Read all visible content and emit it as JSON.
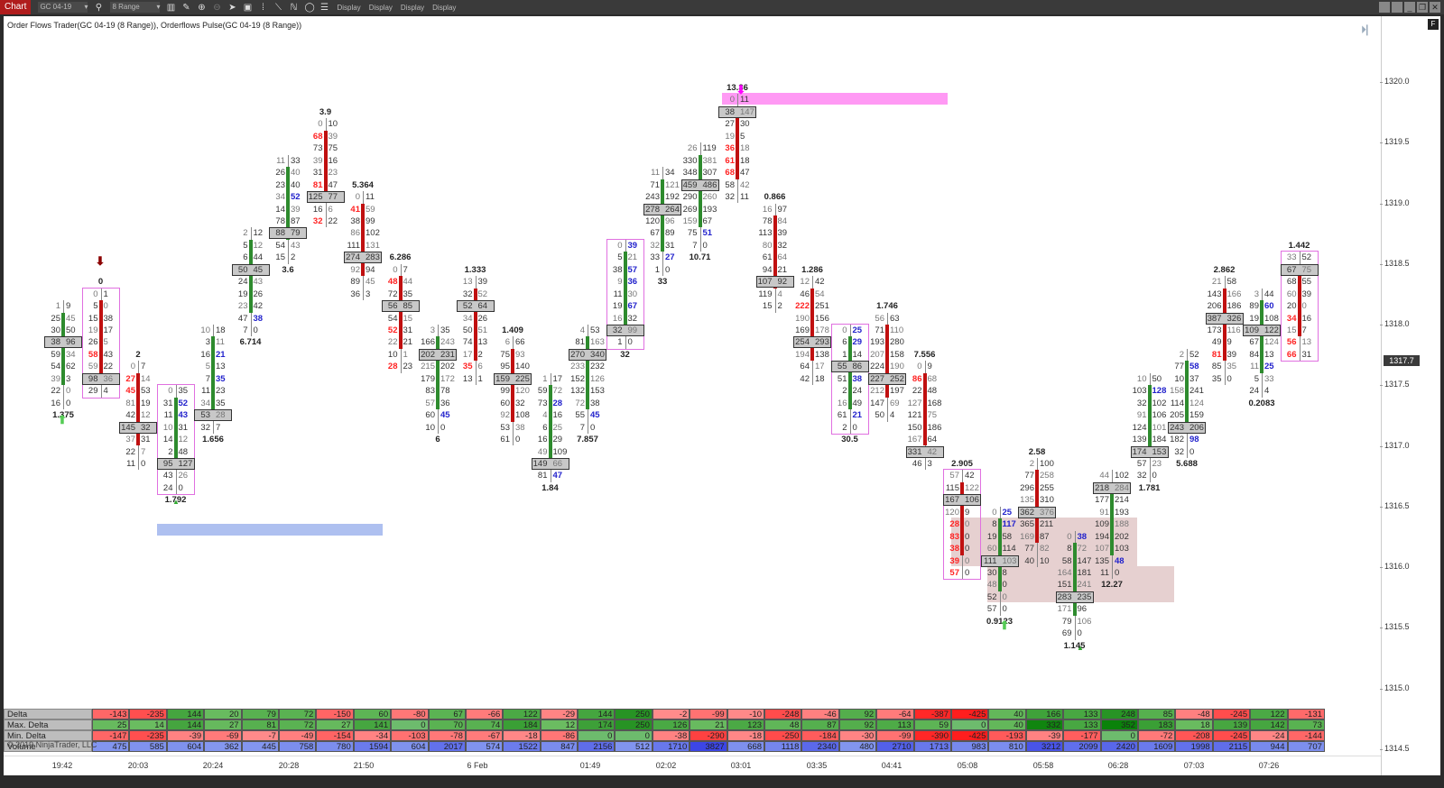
{
  "toolbar": {
    "tab": "Chart",
    "instrument": "GC 04-19",
    "bar_type": "8 Range",
    "display_buttons": [
      "Display",
      "Display",
      "Display",
      "Display"
    ]
  },
  "chart": {
    "title": "Order Flows Trader(GC 04-19 (8 Range)),  Orderflows Pulse(GC 04-19 (8 Range))",
    "f_badge": "F",
    "copyright": "© 2019 NinjaTrader, LLC",
    "last_price": "1317.7",
    "price_ticks": [
      "1320.0",
      "1319.5",
      "1319.0",
      "1318.5",
      "1318.0",
      "1317.5",
      "1317.0",
      "1316.5",
      "1316.0",
      "1315.5",
      "1315.0",
      "1314.5"
    ],
    "time_labels": [
      "19:42",
      "20:03",
      "20:24",
      "20:28",
      "21:50",
      "6 Feb",
      "01:49",
      "02:02",
      "03:01",
      "03:35",
      "04:41",
      "05:08",
      "05:58",
      "06:28",
      "07:03",
      "07:26"
    ]
  },
  "colors": {
    "up": "#2e8b2e",
    "down": "#c01010",
    "poc": "#c8c8c8",
    "highlight": "#e070e0"
  },
  "footprint_bars": [
    {
      "top": 1318.2,
      "dir": "up",
      "bid": [
        1,
        25,
        30,
        38,
        59,
        54,
        39,
        22,
        16
      ],
      "ask": [
        9,
        45,
        50,
        96,
        34,
        62,
        3,
        0,
        0
      ],
      "poc": 3,
      "label": "1.375",
      "label_pos": "bottom"
    },
    {
      "top": 1318.3,
      "dir": "down",
      "bid": [
        0,
        5,
        15,
        19,
        26,
        58,
        59,
        98,
        29
      ],
      "ask": [
        1,
        0,
        38,
        17,
        5,
        43,
        22,
        36,
        4
      ],
      "poc": 7,
      "label": "0",
      "label_pos": "top",
      "boxed": true
    },
    {
      "top": 1317.7,
      "dir": "down",
      "bid": [
        0,
        27,
        45,
        81,
        42,
        145,
        37,
        22,
        11
      ],
      "ask": [
        7,
        14,
        53,
        19,
        12,
        32,
        31,
        7,
        0
      ],
      "poc": 5,
      "label": "2",
      "label_pos": "top"
    },
    {
      "top": 1317.5,
      "dir": "up",
      "bid": [
        0,
        31,
        11,
        10,
        14,
        2,
        95,
        43,
        24
      ],
      "ask": [
        35,
        52,
        43,
        31,
        12,
        48,
        127,
        26,
        0
      ],
      "poc": 6,
      "label": "1.792",
      "label_pos": "bottom",
      "boxed": true
    },
    {
      "top": 1318.0,
      "dir": "up",
      "bid": [
        10,
        3,
        16,
        5,
        7,
        11,
        34,
        53,
        32
      ],
      "ask": [
        18,
        11,
        21,
        13,
        35,
        23,
        35,
        28,
        7
      ],
      "poc": 7,
      "label": "1.656",
      "label_pos": "bottom"
    },
    {
      "top": 1318.8,
      "dir": "up",
      "bid": [
        2,
        5,
        6,
        50,
        24,
        19,
        23,
        47,
        7
      ],
      "ask": [
        12,
        12,
        44,
        45,
        43,
        26,
        42,
        38,
        0
      ],
      "poc": 3,
      "label": "6.714",
      "label_pos": "bottom"
    },
    {
      "top": 1319.4,
      "dir": "up",
      "bid": [
        11,
        26,
        23,
        34,
        14,
        78,
        88,
        54,
        15
      ],
      "ask": [
        33,
        40,
        40,
        52,
        39,
        87,
        79,
        43,
        2
      ],
      "poc": 6,
      "label": "3.6",
      "label_pos": "bottom"
    },
    {
      "top": 1319.7,
      "dir": "down",
      "bid": [
        0,
        68,
        73,
        39,
        31,
        81,
        125,
        16,
        32
      ],
      "ask": [
        10,
        39,
        75,
        16,
        23,
        47,
        77,
        6,
        22
      ],
      "poc": 6,
      "label": "3.9",
      "label_pos": "top"
    },
    {
      "top": 1319.1,
      "dir": "down",
      "bid": [
        0,
        41,
        38,
        86,
        111,
        274,
        92,
        89,
        36
      ],
      "ask": [
        11,
        59,
        99,
        102,
        131,
        283,
        94,
        45,
        3
      ],
      "poc": 5,
      "label": "5.364",
      "label_pos": "top"
    },
    {
      "top": 1318.5,
      "dir": "down",
      "bid": [
        0,
        48,
        72,
        56,
        54,
        52,
        22,
        10,
        28
      ],
      "ask": [
        7,
        44,
        35,
        85,
        15,
        31,
        21,
        1,
        23
      ],
      "poc": 3,
      "label": "6.286",
      "label_pos": "top"
    },
    {
      "top": 1318.0,
      "dir": "up",
      "bid": [
        3,
        166,
        202,
        215,
        179,
        83,
        57,
        60,
        10
      ],
      "ask": [
        35,
        243,
        231,
        202,
        172,
        78,
        36,
        45,
        0
      ],
      "poc": 2,
      "label": "6",
      "label_pos": "bottom"
    },
    {
      "top": 1318.4,
      "dir": "down",
      "bid": [
        13,
        32,
        52,
        34,
        50,
        74,
        17,
        35,
        13
      ],
      "ask": [
        39,
        52,
        64,
        26,
        51,
        13,
        2,
        6,
        1
      ],
      "poc": 2,
      "label": "1.333",
      "label_pos": "top"
    },
    {
      "top": 1317.9,
      "dir": "down",
      "bid": [
        6,
        75,
        95,
        159,
        99,
        60,
        92,
        53,
        61
      ],
      "ask": [
        66,
        93,
        140,
        225,
        120,
        32,
        108,
        38,
        0
      ],
      "poc": 3,
      "label": "1.409",
      "label_pos": "top"
    },
    {
      "top": 1317.6,
      "dir": "up",
      "bid": [
        1,
        59,
        73,
        4,
        6,
        16,
        49,
        149,
        81
      ],
      "ask": [
        17,
        72,
        28,
        16,
        25,
        29,
        109,
        66,
        47
      ],
      "poc": 7,
      "label": "1.84",
      "label_pos": "bottom"
    },
    {
      "top": 1318.0,
      "dir": "up",
      "bid": [
        4,
        81,
        270,
        233,
        152,
        132,
        72,
        55,
        7
      ],
      "ask": [
        53,
        163,
        340,
        232,
        126,
        153,
        38,
        45,
        0
      ],
      "poc": 2,
      "label": "7.857",
      "label_pos": "bottom"
    },
    {
      "top": 1318.7,
      "dir": "up",
      "bid": [
        0,
        5,
        38,
        9,
        11,
        19,
        16,
        32,
        1
      ],
      "ask": [
        39,
        21,
        57,
        36,
        30,
        67,
        32,
        99,
        0
      ],
      "poc": 7,
      "label": "32",
      "label_pos": "bottom",
      "boxed": true
    },
    {
      "top": 1319.3,
      "dir": "up",
      "bid": [
        11,
        71,
        243,
        278,
        120,
        67,
        32,
        33,
        1
      ],
      "ask": [
        34,
        121,
        192,
        264,
        96,
        89,
        31,
        27,
        0
      ],
      "poc": 3,
      "label": "33",
      "label_pos": "bottom"
    },
    {
      "top": 1319.5,
      "dir": "up",
      "bid": [
        26,
        330,
        348,
        459,
        290,
        269,
        159,
        75,
        7
      ],
      "ask": [
        119,
        381,
        307,
        486,
        260,
        193,
        67,
        51,
        0
      ],
      "poc": 3,
      "label": "10.71",
      "label_pos": "bottom"
    },
    {
      "top": 1319.9,
      "dir": "down",
      "bid": [
        0,
        38,
        27,
        19,
        36,
        61,
        68,
        58,
        32
      ],
      "ask": [
        11,
        147,
        30,
        5,
        18,
        18,
        47,
        42,
        11
      ],
      "poc": 1,
      "label": "13.36",
      "label_pos": "top"
    },
    {
      "top": 1319.0,
      "dir": "down",
      "bid": [
        16,
        78,
        113,
        80,
        61,
        94,
        107,
        119,
        15
      ],
      "ask": [
        97,
        84,
        39,
        32,
        64,
        21,
        92,
        4,
        2
      ],
      "poc": 6,
      "label": "0.866",
      "label_pos": "top"
    },
    {
      "top": 1318.4,
      "dir": "down",
      "bid": [
        12,
        46,
        222,
        190,
        169,
        254,
        194,
        64,
        42
      ],
      "ask": [
        42,
        54,
        251,
        156,
        178,
        293,
        138,
        17,
        18
      ],
      "poc": 5,
      "label": "1.286",
      "label_pos": "top"
    },
    {
      "top": 1318.0,
      "dir": "up",
      "bid": [
        0,
        6,
        1,
        55,
        51,
        2,
        16,
        61,
        2
      ],
      "ask": [
        25,
        29,
        14,
        86,
        38,
        24,
        49,
        21,
        0
      ],
      "poc": 3,
      "label": "30.5",
      "label_pos": "bottom",
      "boxed": true
    },
    {
      "top": 1318.1,
      "dir": "down",
      "bid": [
        56,
        71,
        193,
        207,
        224,
        227,
        212,
        147,
        50
      ],
      "ask": [
        63,
        110,
        280,
        158,
        190,
        252,
        197,
        69,
        4
      ],
      "poc": 5,
      "label": "1.746",
      "label_pos": "top"
    },
    {
      "top": 1317.7,
      "dir": "down",
      "bid": [
        0,
        86,
        22,
        127,
        121,
        150,
        167,
        331,
        46
      ],
      "ask": [
        9,
        68,
        48,
        168,
        75,
        186,
        64,
        42,
        3
      ],
      "poc": 7,
      "label": "7.556",
      "label_pos": "top"
    },
    {
      "top": 1316.8,
      "dir": "down",
      "bid": [
        57,
        115,
        167,
        120,
        28,
        83,
        38,
        39,
        57
      ],
      "ask": [
        42,
        122,
        106,
        9,
        0,
        0,
        0,
        0,
        0
      ],
      "poc": 2,
      "label": "2.905",
      "label_pos": "top",
      "boxed": true
    },
    {
      "top": 1316.5,
      "dir": "up",
      "bid": [
        0,
        8,
        19,
        60,
        111,
        30,
        48,
        52,
        57
      ],
      "ask": [
        25,
        117,
        58,
        114,
        103,
        8,
        0,
        0,
        0
      ],
      "poc": 4,
      "label": "0.9123",
      "label_pos": "bottom"
    },
    {
      "top": 1316.9,
      "dir": "down",
      "bid": [
        2,
        77,
        296,
        135,
        362,
        365,
        169,
        77,
        40
      ],
      "ask": [
        100,
        258,
        255,
        310,
        376,
        211,
        87,
        82,
        10
      ],
      "poc": 4,
      "label": "2.58",
      "label_pos": "top"
    },
    {
      "top": 1316.3,
      "dir": "up",
      "bid": [
        0,
        8,
        58,
        164,
        151,
        283,
        171,
        79,
        69
      ],
      "ask": [
        38,
        72,
        147,
        181,
        241,
        235,
        96,
        106,
        0
      ],
      "poc": 5,
      "label": "1.145",
      "label_pos": "bottom"
    },
    {
      "top": 1316.8,
      "dir": "up",
      "bid": [
        44,
        218,
        177,
        91,
        109,
        194,
        107,
        135,
        11
      ],
      "ask": [
        102,
        284,
        214,
        193,
        188,
        202,
        103,
        48,
        0
      ],
      "poc": 1,
      "label": "12.27",
      "label_pos": "bottom"
    },
    {
      "top": 1317.6,
      "dir": "up",
      "bid": [
        10,
        103,
        32,
        91,
        124,
        139,
        174,
        57,
        32
      ],
      "ask": [
        50,
        128,
        102,
        106,
        101,
        184,
        153,
        23,
        0
      ],
      "poc": 6,
      "label": "1.781",
      "label_pos": "bottom"
    },
    {
      "top": 1317.8,
      "dir": "up",
      "bid": [
        2,
        77,
        10,
        158,
        114,
        205,
        243,
        182,
        32
      ],
      "ask": [
        52,
        58,
        37,
        241,
        124,
        159,
        206,
        98,
        0
      ],
      "poc": 6,
      "label": "5.688",
      "label_pos": "bottom"
    },
    {
      "top": 1318.4,
      "dir": "down",
      "bid": [
        21,
        143,
        206,
        387,
        173,
        49,
        81,
        85,
        35
      ],
      "ask": [
        58,
        166,
        186,
        326,
        116,
        9,
        39,
        35,
        0
      ],
      "poc": 3,
      "label": "2.862",
      "label_pos": "top"
    },
    {
      "top": 1318.3,
      "dir": "up",
      "bid": [
        3,
        89,
        19,
        109,
        67,
        84,
        11,
        5,
        24
      ],
      "ask": [
        44,
        60,
        108,
        122,
        124,
        13,
        25,
        33,
        4
      ],
      "poc": 3,
      "label": "0.2083",
      "label_pos": "bottom"
    },
    {
      "top": 1318.6,
      "dir": "down",
      "bid": [
        33,
        67,
        68,
        60,
        20,
        34,
        15,
        56,
        66
      ],
      "ask": [
        52,
        75,
        55,
        39,
        0,
        16,
        7,
        13,
        31
      ],
      "poc": 1,
      "label": "1.442",
      "label_pos": "top",
      "boxed": true
    }
  ],
  "stats_table": {
    "rows": [
      {
        "name": "Delta",
        "values": [
          -143,
          -235,
          144,
          20,
          79,
          72,
          -150,
          60,
          -80,
          67,
          -66,
          122,
          -29,
          144,
          250,
          -2,
          -99,
          -10,
          -248,
          -46,
          92,
          -64,
          -387,
          -425,
          40,
          166,
          133,
          248,
          85,
          -48,
          -245,
          122,
          -131
        ]
      },
      {
        "name": "Max. Delta",
        "values": [
          25,
          14,
          144,
          27,
          81,
          72,
          27,
          141,
          0,
          70,
          74,
          184,
          12,
          174,
          250,
          126,
          21,
          123,
          48,
          87,
          92,
          113,
          59,
          0,
          40,
          332,
          133,
          352,
          183,
          18,
          139,
          142,
          73
        ]
      },
      {
        "name": "Min. Delta",
        "values": [
          -147,
          -235,
          -39,
          -69,
          -7,
          -49,
          -154,
          -34,
          -103,
          -78,
          -67,
          -18,
          -86,
          0,
          0,
          -38,
          -290,
          -18,
          -250,
          -184,
          -30,
          -99,
          -390,
          -425,
          -193,
          -39,
          -177,
          0,
          -72,
          -208,
          -245,
          -24,
          -144
        ]
      },
      {
        "name": "Volume",
        "values": [
          475,
          585,
          604,
          362,
          445,
          758,
          780,
          1594,
          604,
          2017,
          574,
          1522,
          847,
          2156,
          512,
          1710,
          3827,
          668,
          1118,
          2340,
          480,
          2710,
          1713,
          983,
          810,
          3212,
          2099,
          2420,
          1609,
          1998,
          2115,
          944,
          707
        ]
      }
    ]
  }
}
